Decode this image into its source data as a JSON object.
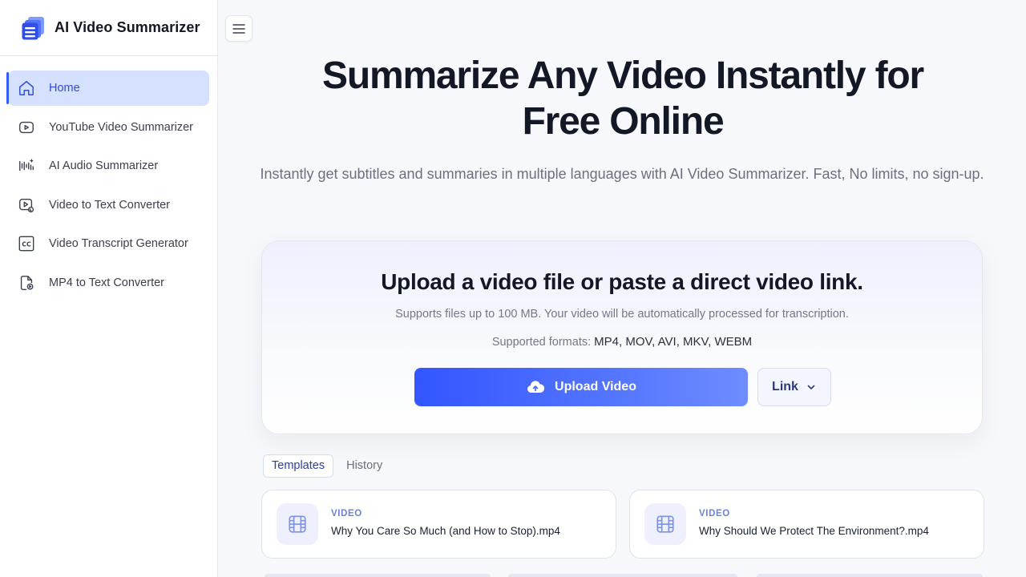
{
  "brand": {
    "name": "AI Video Summarizer",
    "logo_icon": "stacked-layers-icon",
    "accent": "#2f5bff"
  },
  "sidebar": {
    "items": [
      {
        "label": "Home",
        "icon": "home-icon",
        "active": true
      },
      {
        "label": "YouTube Video Summarizer",
        "icon": "youtube-icon",
        "active": false
      },
      {
        "label": "AI Audio Summarizer",
        "icon": "audio-wave-icon",
        "active": false
      },
      {
        "label": "Video to Text Converter",
        "icon": "video-text-icon",
        "active": false
      },
      {
        "label": "Video Transcript Generator",
        "icon": "cc-icon",
        "active": false
      },
      {
        "label": "MP4 to Text Converter",
        "icon": "file-icon",
        "active": false
      }
    ]
  },
  "header": {
    "menu_icon": "hamburger-menu-icon"
  },
  "hero": {
    "title_line1": "Summarize Any Video Instantly for",
    "title_line2": "Free Online",
    "subtitle": "Instantly get subtitles and summaries in multiple languages with AI Video Summarizer. Fast, No limits, no sign-up."
  },
  "upload": {
    "title": "Upload a video file or paste a direct video link.",
    "note": "Supports files up to 100 MB. Your video will be automatically processed for transcription.",
    "formats_label": "Supported formats:",
    "formats_value": "MP4, MOV, AVI, MKV, WEBM",
    "upload_button": "Upload Video",
    "link_button": "Link"
  },
  "tabs": [
    {
      "label": "Templates",
      "active": true
    },
    {
      "label": "History",
      "active": false
    }
  ],
  "templates": [
    {
      "kind": "VIDEO",
      "name": "Why You Care So Much (and How to Stop).mp4",
      "icon": "film-icon"
    },
    {
      "kind": "VIDEO",
      "name": "Why Should We Protect The Environment?.mp4",
      "icon": "film-icon"
    }
  ]
}
